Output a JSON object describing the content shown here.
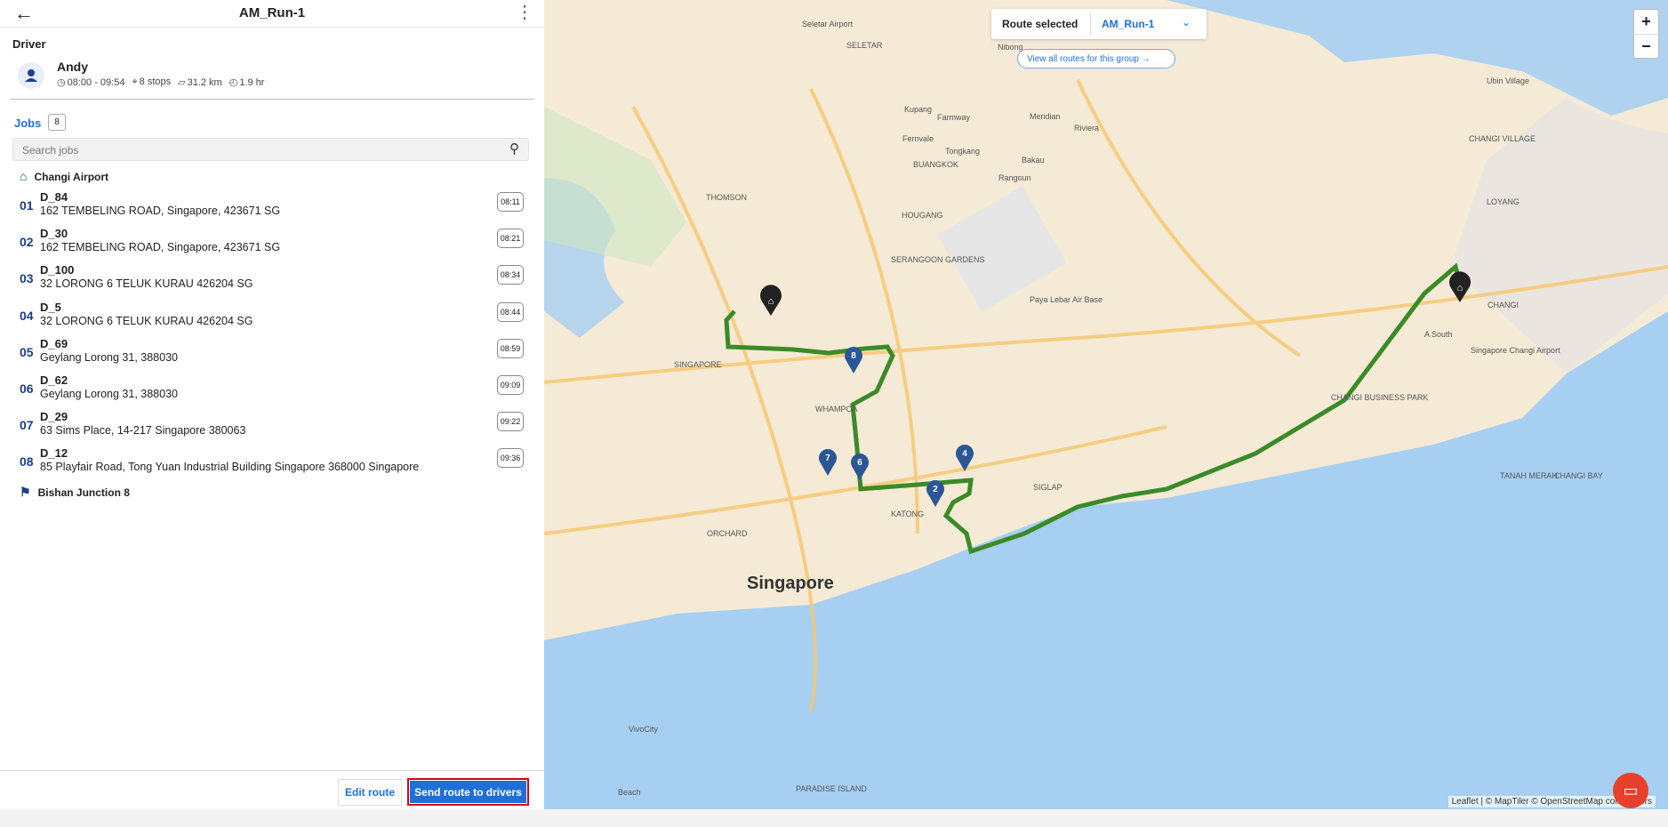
{
  "header": {
    "title": "AM_Run-1"
  },
  "driver": {
    "section_label": "Driver",
    "name": "Andy",
    "time_range": "08:00 - 09:54",
    "stops": "8 stops",
    "distance": "31.2 km",
    "duration": "1.9 hr"
  },
  "jobs": {
    "label": "Jobs",
    "count": "8",
    "search_placeholder": "Search jobs",
    "start": "Changi Airport",
    "end": "Bishan Junction 8",
    "items": [
      {
        "num": "01",
        "name": "D_84",
        "address": "162 TEMBELING ROAD, Singapore, 423671 SG",
        "time": "08:11"
      },
      {
        "num": "02",
        "name": "D_30",
        "address": "162 TEMBELING ROAD, Singapore, 423671 SG",
        "time": "08:21"
      },
      {
        "num": "03",
        "name": "D_100",
        "address": "32 LORONG 6 TELUK KURAU 426204 SG",
        "time": "08:34"
      },
      {
        "num": "04",
        "name": "D_5",
        "address": "32 LORONG 6 TELUK KURAU 426204 SG",
        "time": "08:44"
      },
      {
        "num": "05",
        "name": "D_69",
        "address": "Geylang Lorong 31, 388030",
        "time": "08:59"
      },
      {
        "num": "06",
        "name": "D_62",
        "address": "Geylang Lorong 31, 388030",
        "time": "09:09"
      },
      {
        "num": "07",
        "name": "D_29",
        "address": "63 Sims Place, 14-217 Singapore 380063",
        "time": "09:22"
      },
      {
        "num": "08",
        "name": "D_12",
        "address": "85 Playfair Road, Tong Yuan Industrial Building Singapore 368000 Singapore",
        "time": "09:36"
      }
    ]
  },
  "footer": {
    "edit_label": "Edit route",
    "send_label": "Send route to drivers"
  },
  "map": {
    "route_selected_label": "Route selected",
    "route_selected_value": "AM_Run-1",
    "view_all_label": "View all routes for this group",
    "attribution": "Leaflet | © MapTiler © OpenStreetMap contributors",
    "city_label": "Singapore",
    "place_labels": [
      "Seletar Airport",
      "SELETAR",
      "Nibong",
      "Ubin Village",
      "Kupang",
      "Farmway",
      "Meridian",
      "Riviera",
      "Fernvale",
      "Tongkang",
      "Bakau",
      "Rangoun",
      "BUANGKOK",
      "THOMSON",
      "HOUGANG",
      "SERANGOON GARDENS",
      "CHANGI VILLAGE",
      "LOYANG",
      "CHANGI",
      "Paya Lebar Air Base",
      "CHANGI BUSINESS PARK",
      "SINGAPORE",
      "WHAMPOA",
      "SIGLAP",
      "KATONG",
      "TANAH MERAH",
      "CHANGI BAY",
      "ORCHARD",
      "Singapore Changi Airport",
      "A South",
      "VivoCity",
      "Beach",
      "PARADISE ISLAND"
    ],
    "stop_numbers": [
      "2",
      "4",
      "6",
      "7",
      "8"
    ],
    "colors": {
      "route": "#3a8b27",
      "marker": "#2b5797",
      "water": "#a6cff2",
      "land": "#f4ead6"
    }
  }
}
